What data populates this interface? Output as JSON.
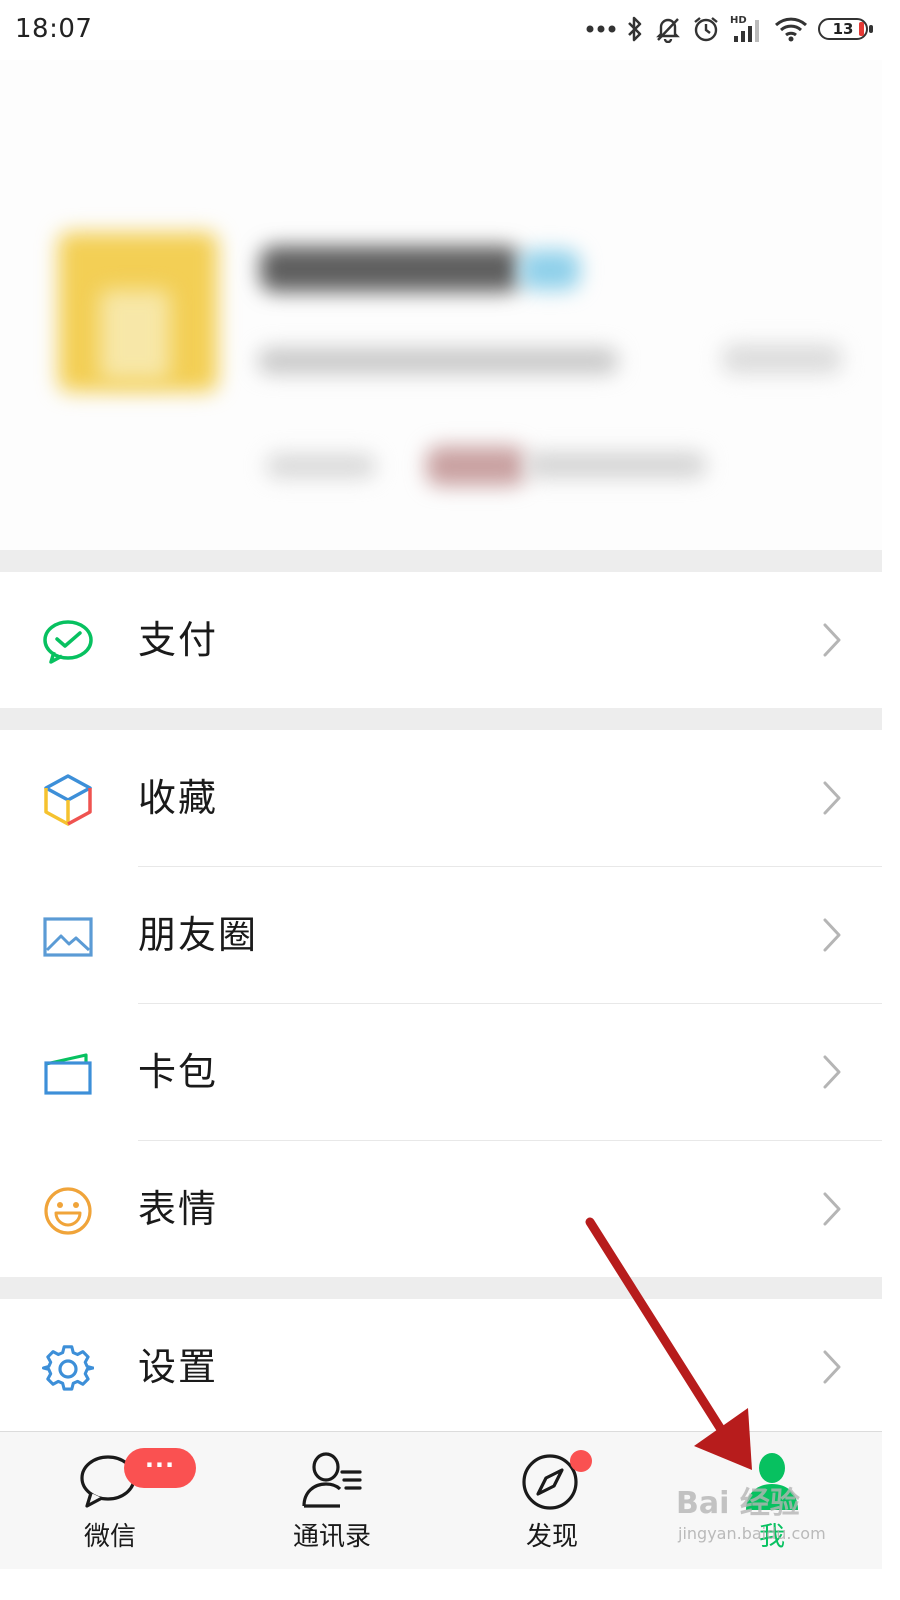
{
  "status_bar": {
    "time": "18:07",
    "icons": [
      "more-dots-icon",
      "bluetooth-icon",
      "mute-bell-icon",
      "alarm-icon",
      "hd-signal-icon",
      "wifi-icon",
      "battery-icon"
    ],
    "battery_level": "13",
    "hd_text": "HD"
  },
  "menu": {
    "pay": {
      "label": "支付",
      "icon": "wechat-pay-icon",
      "color": "#07c160"
    },
    "favorites": {
      "label": "收藏",
      "icon": "cube-icon"
    },
    "moments": {
      "label": "朋友圈",
      "icon": "photo-icon",
      "color": "#5b9bd5"
    },
    "cards": {
      "label": "卡包",
      "icon": "card-wallet-icon",
      "color": "#3d8fd8"
    },
    "stickers": {
      "label": "表情",
      "icon": "smiley-icon",
      "color": "#f0a43a"
    },
    "settings": {
      "label": "设置",
      "icon": "gear-icon",
      "color": "#3d8fd8"
    }
  },
  "tabbar": {
    "tabs": [
      {
        "label": "微信",
        "icon": "chat-bubble-icon",
        "badge": "···"
      },
      {
        "label": "通讯录",
        "icon": "contacts-icon"
      },
      {
        "label": "发现",
        "icon": "compass-icon"
      },
      {
        "label": "我",
        "icon": "person-icon",
        "active": true
      }
    ],
    "active_color": "#07c160",
    "badge_color": "#fa5151"
  },
  "watermark": {
    "brand": "Bai 经验",
    "url": "jingyan.baidu.com"
  },
  "annotation": {
    "type": "arrow",
    "color": "#b71c1c",
    "points_to": "tab-me"
  }
}
